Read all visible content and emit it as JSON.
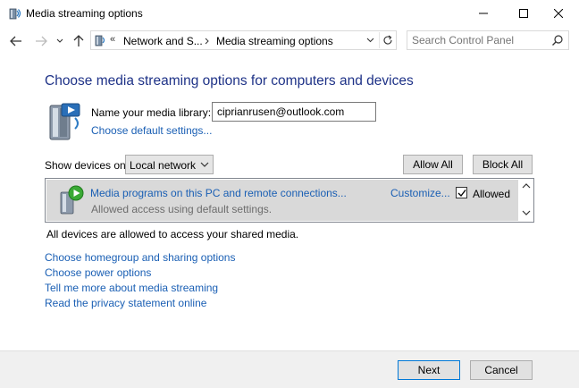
{
  "window": {
    "title": "Media streaming options",
    "app_icon": "media-streaming-icon",
    "controls": [
      "minimize-icon",
      "maximize-icon",
      "close-icon"
    ]
  },
  "nav": {
    "address": {
      "overflow": "«",
      "crumbs": [
        "Network and S...",
        "Media streaming options"
      ]
    },
    "search": {
      "placeholder": "Search Control Panel"
    }
  },
  "main": {
    "heading": "Choose media streaming options for computers and devices",
    "library": {
      "label": "Name your media library:",
      "value": "ciprianrusen@outlook.com",
      "defaults_link": "Choose default settings..."
    },
    "show_devices": {
      "label": "Show devices on:",
      "selected": "Local network"
    },
    "buttons": {
      "allow_all": "Allow All",
      "block_all": "Block All"
    },
    "device_row": {
      "title": "Media programs on this PC and remote connections...",
      "subtitle": "Allowed access using default settings.",
      "customize": "Customize...",
      "allowed_label": "Allowed",
      "allowed_checked": true
    },
    "status_message": "All devices are allowed to access your shared media.",
    "links": {
      "homegroup": "Choose homegroup and sharing options",
      "power": "Choose power options",
      "more": "Tell me more about media streaming",
      "privacy": "Read the privacy statement online"
    }
  },
  "footer": {
    "next": "Next",
    "cancel": "Cancel"
  },
  "colors": {
    "heading": "#1e3287",
    "link": "#1a5fb4",
    "row_bg": "#d9d9d9",
    "accent": "#0078d7"
  }
}
